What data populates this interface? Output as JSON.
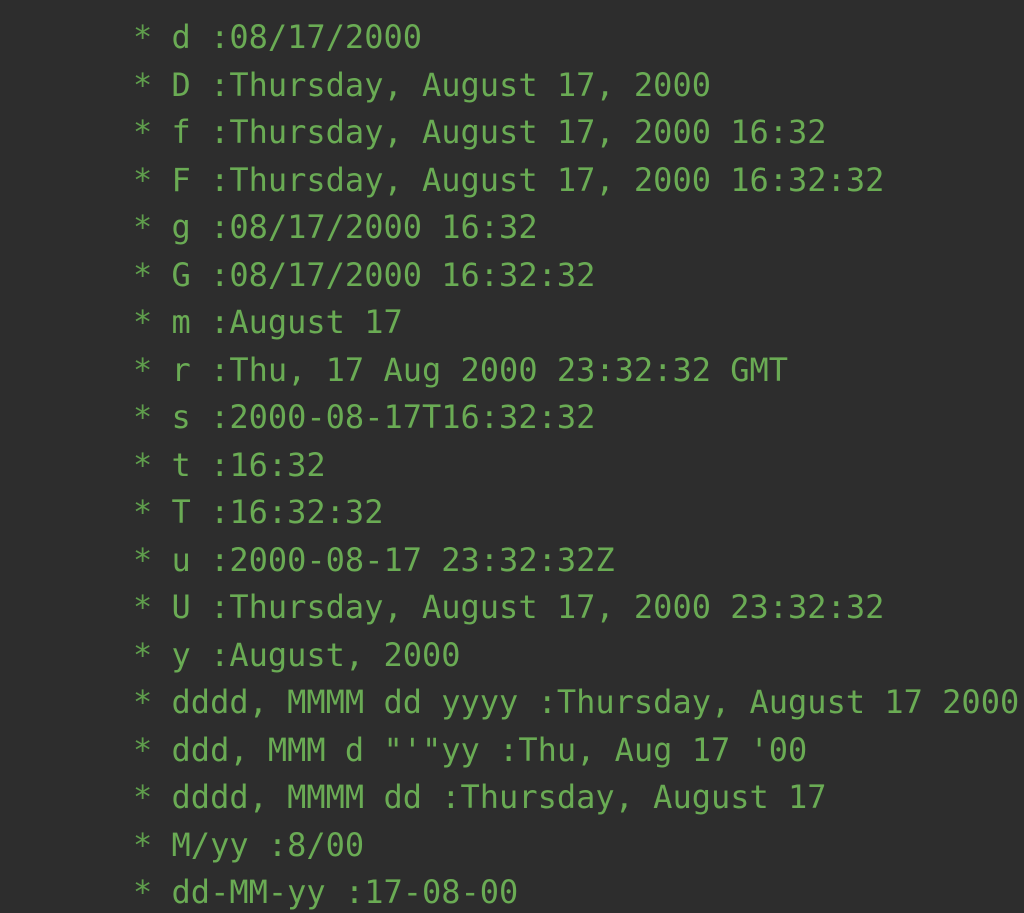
{
  "theme": {
    "background": "#2d2d2d",
    "text_green": "#6aab54",
    "bullet_green": "#5f9e4c"
  },
  "doc_comment": {
    "bullet": "*",
    "separator": ":",
    "lines": [
      {
        "bullet": "*",
        "specifier": "d ",
        "separator": ":",
        "value": "08/17/2000"
      },
      {
        "bullet": "*",
        "specifier": "D ",
        "separator": ":",
        "value": "Thursday, August 17, 2000"
      },
      {
        "bullet": "*",
        "specifier": "f ",
        "separator": ":",
        "value": "Thursday, August 17, 2000 16:32"
      },
      {
        "bullet": "*",
        "specifier": "F ",
        "separator": ":",
        "value": "Thursday, August 17, 2000 16:32:32"
      },
      {
        "bullet": "*",
        "specifier": "g ",
        "separator": ":",
        "value": "08/17/2000 16:32"
      },
      {
        "bullet": "*",
        "specifier": "G ",
        "separator": ":",
        "value": "08/17/2000 16:32:32"
      },
      {
        "bullet": "*",
        "specifier": "m ",
        "separator": ":",
        "value": "August 17"
      },
      {
        "bullet": "*",
        "specifier": "r ",
        "separator": ":",
        "value": "Thu, 17 Aug 2000 23:32:32 GMT"
      },
      {
        "bullet": "*",
        "specifier": "s ",
        "separator": ":",
        "value": "2000-08-17T16:32:32"
      },
      {
        "bullet": "*",
        "specifier": "t ",
        "separator": ":",
        "value": "16:32"
      },
      {
        "bullet": "*",
        "specifier": "T ",
        "separator": ":",
        "value": "16:32:32"
      },
      {
        "bullet": "*",
        "specifier": "u ",
        "separator": ":",
        "value": "2000-08-17 23:32:32Z"
      },
      {
        "bullet": "*",
        "specifier": "U ",
        "separator": ":",
        "value": "Thursday, August 17, 2000 23:32:32"
      },
      {
        "bullet": "*",
        "specifier": "y ",
        "separator": ":",
        "value": "August, 2000"
      },
      {
        "bullet": "*",
        "specifier": "dddd, MMMM dd yyyy ",
        "separator": ":",
        "value": "Thursday, August 17 2000"
      },
      {
        "bullet": "*",
        "specifier": "ddd, MMM d \"'\"yy ",
        "separator": ":",
        "value": "Thu, Aug 17 '00"
      },
      {
        "bullet": "*",
        "specifier": "dddd, MMMM dd ",
        "separator": ":",
        "value": "Thursday, August 17"
      },
      {
        "bullet": "*",
        "specifier": "M/yy ",
        "separator": ":",
        "value": "8/00"
      },
      {
        "bullet": "*",
        "specifier": "dd-MM-yy ",
        "separator": ":",
        "value": "17-08-00"
      }
    ]
  }
}
